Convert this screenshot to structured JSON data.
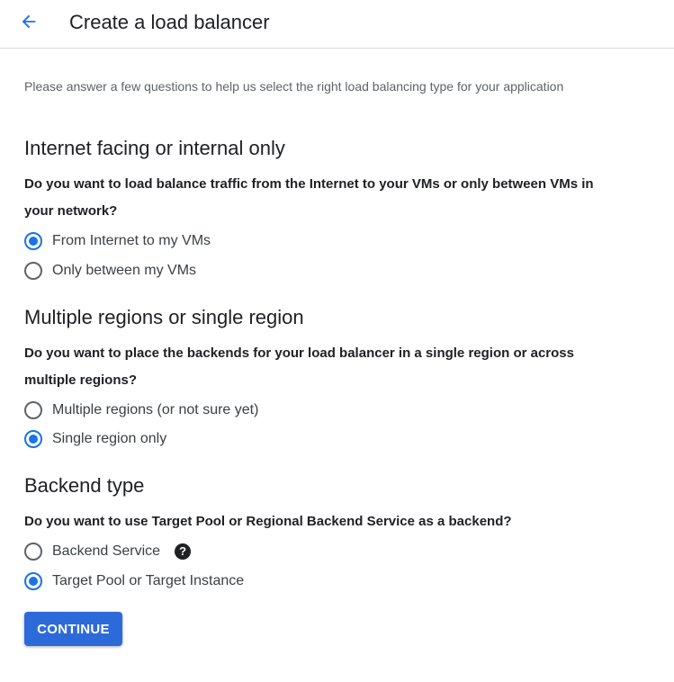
{
  "header": {
    "back_icon": "arrow-back-icon",
    "title": "Create a load balancer"
  },
  "intro": "Please answer a few questions to help us select the right load balancing type for your application",
  "sections": [
    {
      "title": "Internet facing or internal only",
      "question": "Do you want to load balance traffic from the Internet to your VMs or only between VMs in your network?",
      "options": [
        {
          "label": "From Internet to my VMs",
          "selected": true
        },
        {
          "label": "Only between my VMs",
          "selected": false
        }
      ]
    },
    {
      "title": "Multiple regions or single region",
      "question": "Do you want to place the backends for your load balancer in a single region or across multiple regions?",
      "options": [
        {
          "label": "Multiple regions (or not sure yet)",
          "selected": false
        },
        {
          "label": "Single region only",
          "selected": true
        }
      ]
    },
    {
      "title": "Backend type",
      "question": "Do you want to use Target Pool or Regional Backend Service as a backend?",
      "options": [
        {
          "label": "Backend Service",
          "selected": false,
          "help_icon": "help-icon",
          "help_glyph": "?"
        },
        {
          "label": "Target Pool or Target Instance",
          "selected": true
        }
      ]
    }
  ],
  "continue_label": "CONTINUE",
  "colors": {
    "accent": "#1a73e8",
    "button": "#2d6ad9",
    "text": "#202124",
    "muted": "#5f6368"
  }
}
